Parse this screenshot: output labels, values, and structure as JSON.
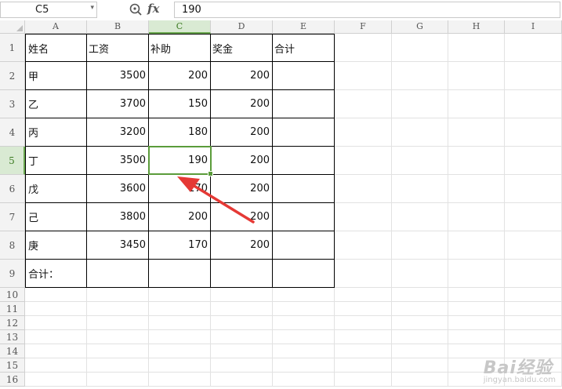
{
  "formula_bar": {
    "name_box": "C5",
    "formula_value": "190",
    "fx_label": "fx"
  },
  "columns": [
    "A",
    "B",
    "C",
    "D",
    "E",
    "F",
    "G",
    "H",
    "I"
  ],
  "rows": [
    "1",
    "2",
    "3",
    "4",
    "5",
    "6",
    "7",
    "8",
    "9",
    "10",
    "11",
    "12",
    "13",
    "14",
    "15",
    "16"
  ],
  "table": {
    "header": [
      "姓名",
      "工资",
      "补助",
      "奖金",
      "合计"
    ],
    "body": [
      [
        "甲",
        "3500",
        "200",
        "200",
        ""
      ],
      [
        "乙",
        "3700",
        "150",
        "200",
        ""
      ],
      [
        "丙",
        "3200",
        "180",
        "200",
        ""
      ],
      [
        "丁",
        "3500",
        "190",
        "200",
        ""
      ],
      [
        "戊",
        "3600",
        "170",
        "200",
        ""
      ],
      [
        "己",
        "3800",
        "200",
        "200",
        ""
      ],
      [
        "庚",
        "3450",
        "170",
        "200",
        ""
      ],
      [
        "合计：",
        "",
        "",
        "",
        ""
      ]
    ]
  },
  "selection": {
    "cell": "C5"
  },
  "colors": {
    "selection": "#5b9c3b",
    "active_header": "#d9ead3",
    "arrow": "#e53935"
  },
  "watermark": {
    "main": "Bai经验",
    "sub": "jingyan.baidu.com"
  }
}
